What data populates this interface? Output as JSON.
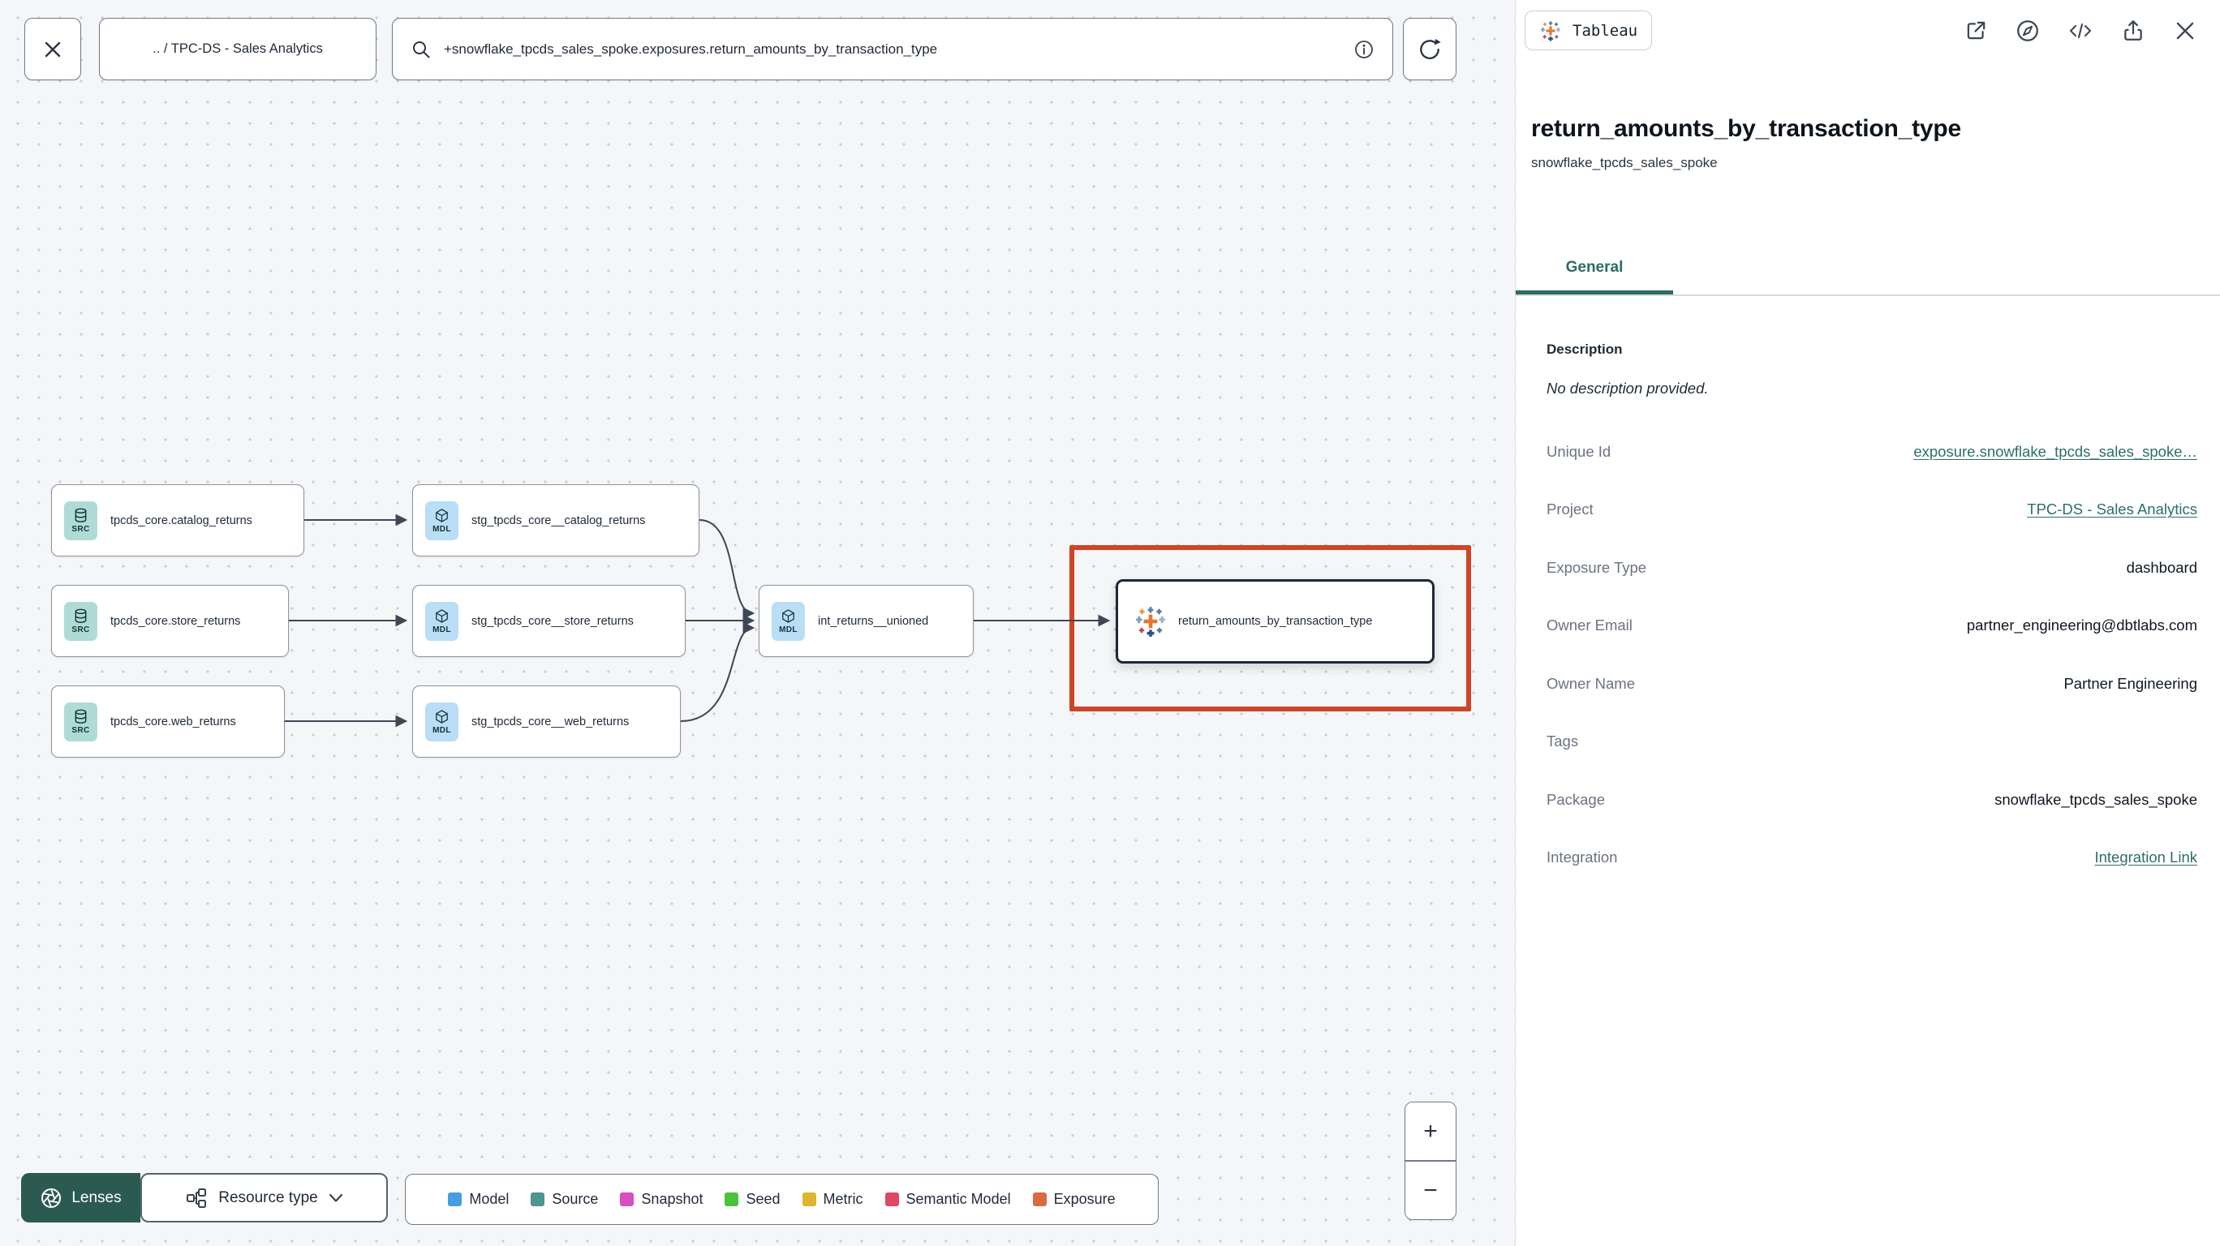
{
  "topbar": {
    "breadcrumb": ".. / TPC-DS - Sales Analytics",
    "search_value": "+snowflake_tpcds_sales_spoke.exposures.return_amounts_by_transaction_type"
  },
  "graph": {
    "nodes": [
      {
        "label": "tpcds_core.catalog_returns",
        "type": "source",
        "badge": "SRC"
      },
      {
        "label": "tpcds_core.store_returns",
        "type": "source",
        "badge": "SRC"
      },
      {
        "label": "tpcds_core.web_returns",
        "type": "source",
        "badge": "SRC"
      },
      {
        "label": "stg_tpcds_core__catalog_returns",
        "type": "model",
        "badge": "MDL"
      },
      {
        "label": "stg_tpcds_core__store_returns",
        "type": "model",
        "badge": "MDL"
      },
      {
        "label": "stg_tpcds_core__web_returns",
        "type": "model",
        "badge": "MDL"
      },
      {
        "label": "int_returns__unioned",
        "type": "model",
        "badge": "MDL"
      },
      {
        "label": "return_amounts_by_transaction_type",
        "type": "exposure",
        "icon": "tableau-logo"
      }
    ]
  },
  "controls": {
    "lenses": "Lenses",
    "resource_type": "Resource type",
    "zoom_in": "+",
    "zoom_out": "−"
  },
  "legend": {
    "items": [
      {
        "label": "Model",
        "color": "#459de2"
      },
      {
        "label": "Source",
        "color": "#4e948f"
      },
      {
        "label": "Snapshot",
        "color": "#d94ec0"
      },
      {
        "label": "Seed",
        "color": "#4cc13c"
      },
      {
        "label": "Metric",
        "color": "#ddb52e"
      },
      {
        "label": "Semantic Model",
        "color": "#de4861"
      },
      {
        "label": "Exposure",
        "color": "#d96a41"
      }
    ]
  },
  "panel": {
    "integration_badge": "Tableau",
    "header_icons": [
      "open-in-new-icon",
      "explore-icon",
      "code-icon",
      "share-icon",
      "close-icon"
    ],
    "title": "return_amounts_by_transaction_type",
    "subtitle": "snowflake_tpcds_sales_spoke",
    "tab": "General",
    "description_heading": "Description",
    "description_empty": "No description provided.",
    "rows": [
      {
        "label": "Unique Id",
        "value": "exposure.snowflake_tpcds_sales_spoke…",
        "link": true
      },
      {
        "label": "Project",
        "value": "TPC-DS - Sales Analytics",
        "link": true
      },
      {
        "label": "Exposure Type",
        "value": "dashboard",
        "link": false
      },
      {
        "label": "Owner Email",
        "value": "partner_engineering@dbtlabs.com",
        "link": false
      },
      {
        "label": "Owner Name",
        "value": "Partner Engineering",
        "link": false
      },
      {
        "label": "Tags",
        "value": "",
        "link": false
      },
      {
        "label": "Package",
        "value": "snowflake_tpcds_sales_spoke",
        "link": false
      },
      {
        "label": "Integration",
        "value": "Integration Link",
        "link": true
      }
    ]
  },
  "colors": {
    "link_teal": "#2d6e6b",
    "tab_teal": "#2d6a66",
    "selection_red": "#ce4527",
    "lenses_green": "#2b5a51",
    "source_icon_bg": "#aedcd4",
    "model_icon_bg": "#b9def5"
  }
}
